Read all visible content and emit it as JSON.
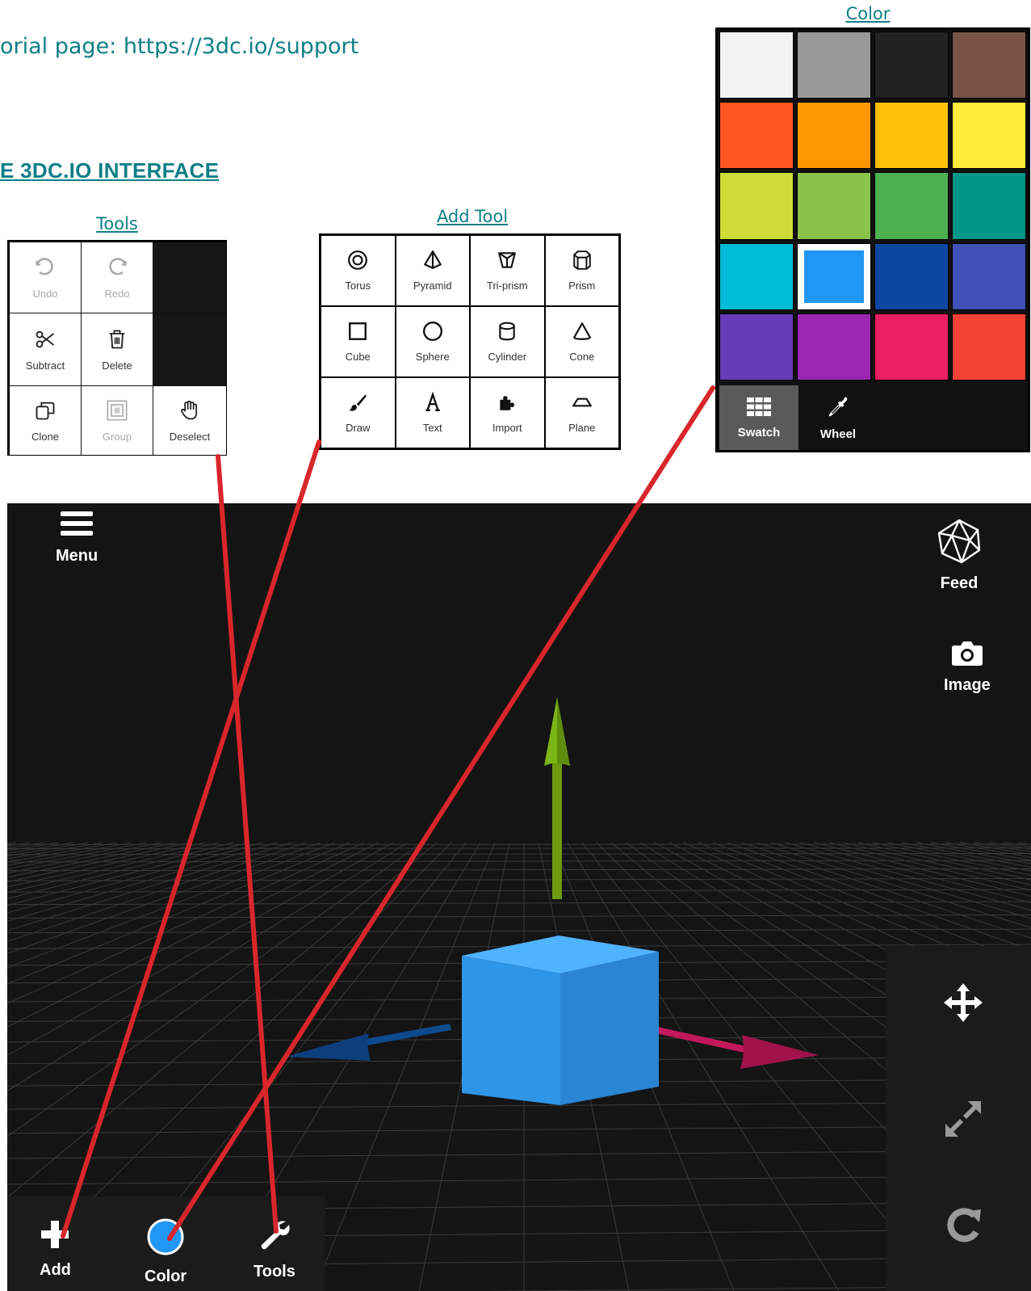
{
  "intro": {
    "tutorial_text": "orial page: https://3dc.io/support"
  },
  "heading": {
    "text": "E 3DC.IO INTERFACE"
  },
  "tools_panel": {
    "caption": "Tools",
    "items": [
      {
        "label": "Undo",
        "icon": "undo-icon",
        "disabled": true
      },
      {
        "label": "Redo",
        "icon": "redo-icon",
        "disabled": true
      },
      {
        "label": "Subtract",
        "icon": "scissors-icon",
        "disabled": false
      },
      {
        "label": "Delete",
        "icon": "trash-icon",
        "disabled": false
      },
      {
        "label": "Clone",
        "icon": "clone-icon",
        "disabled": false
      },
      {
        "label": "Group",
        "icon": "group-icon",
        "disabled": true
      },
      {
        "label": "Deselect",
        "icon": "hand-icon",
        "disabled": false
      }
    ]
  },
  "add_panel": {
    "caption": "Add Tool",
    "items": [
      {
        "label": "Torus",
        "icon": "torus-icon"
      },
      {
        "label": "Pyramid",
        "icon": "pyramid-icon"
      },
      {
        "label": "Tri-prism",
        "icon": "triprism-icon"
      },
      {
        "label": "Prism",
        "icon": "prism-icon"
      },
      {
        "label": "Cube",
        "icon": "cube-icon"
      },
      {
        "label": "Sphere",
        "icon": "sphere-icon"
      },
      {
        "label": "Cylinder",
        "icon": "cylinder-icon"
      },
      {
        "label": "Cone",
        "icon": "cone-icon"
      },
      {
        "label": "Draw",
        "icon": "brush-icon"
      },
      {
        "label": "Text",
        "icon": "text-icon"
      },
      {
        "label": "Import",
        "icon": "puzzle-icon"
      },
      {
        "label": "Plane",
        "icon": "plane-icon"
      }
    ]
  },
  "color_panel": {
    "caption": "Color",
    "swatches": [
      "#f2f2f2",
      "#999999",
      "#222222",
      "#795548",
      "#ff5722",
      "#ff9800",
      "#ffc107",
      "#ffeb3b",
      "#cddc39",
      "#8bc34a",
      "#4caf50",
      "#009688",
      "#00bcd4",
      "#2196f3",
      "#0d47a1",
      "#3f51b5",
      "#673ab7",
      "#9c27b0",
      "#e91e63",
      "#f44336"
    ],
    "selected_index": 13,
    "tabs": [
      {
        "label": "Swatch",
        "icon": "grid-icon",
        "active": true
      },
      {
        "label": "Wheel",
        "icon": "eyedropper-icon",
        "active": false
      }
    ]
  },
  "viewport": {
    "menu_label": "Menu",
    "feed_label": "Feed",
    "image_label": "Image",
    "bottom": {
      "add_label": "Add",
      "color_label": "Color",
      "tools_label": "Tools",
      "current_color": "#2196f3"
    },
    "cube_color": "#2f95e6",
    "axis_colors": {
      "y": "#7cb518",
      "x": "#c2185b",
      "z": "#0d4a8f"
    }
  },
  "annotation_color": "#d9262b"
}
